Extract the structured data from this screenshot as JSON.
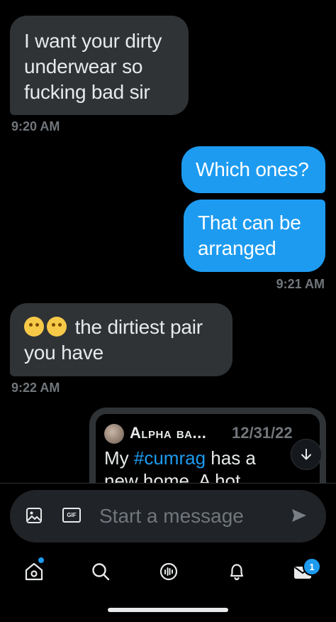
{
  "messages": [
    {
      "text": "I want your dirty underwear so fucking bad sir",
      "time": "9:20 AM"
    },
    {
      "text": "Which ones?"
    },
    {
      "text": "That can be arranged",
      "time": "9:21 AM"
    },
    {
      "text": "the dirtiest pair you have",
      "time": "9:22 AM",
      "emojis": [
        "drooling-face",
        "dizzy-face"
      ]
    }
  ],
  "quoted_tweet": {
    "author": "Alpha ba...",
    "date": "12/31/22",
    "text_before": "My ",
    "hashtag": "#cumrag",
    "text_after": " has a new home. A hot"
  },
  "composer": {
    "placeholder": "Start a message",
    "gif_label": "GIF"
  },
  "nav": {
    "messages_badge": "1"
  },
  "colors": {
    "background": "#000000",
    "incoming_bubble": "#2f3336",
    "outgoing_bubble": "#1d9bf0",
    "timestamp": "#71767b",
    "accent": "#1d9bf0"
  },
  "icons": [
    "image-icon",
    "gif-icon",
    "send-icon",
    "home-icon",
    "search-icon",
    "spaces-icon",
    "bell-icon",
    "mail-icon",
    "arrow-down-icon"
  ]
}
